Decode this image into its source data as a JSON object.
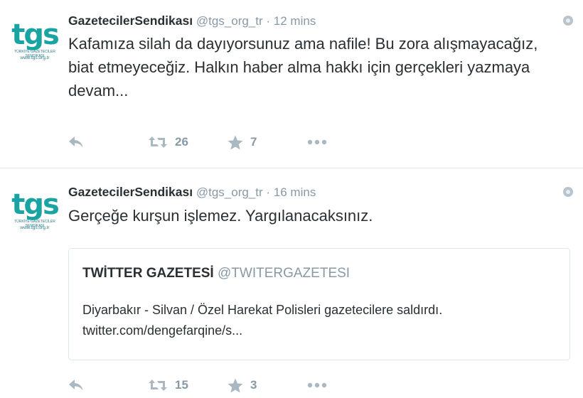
{
  "tweets": [
    {
      "avatar": {
        "logo": "tgs",
        "subtitle": "TÜRKİYE GAZETECİLER SENDİKASI",
        "url": "www.tgs.org.tr"
      },
      "name": "GazetecilerSendikası",
      "handle": "@tgs_org_tr",
      "separator": "·",
      "time": "12 mins",
      "text": "Kafamıza silah da dayıyorsunuz ama nafile! Bu zora alışmayacağız, biat etmeyeceğiz. Halkın haber alma hakkı için gerçekleri yazmaya devam...",
      "retweets": "26",
      "favorites": "7"
    },
    {
      "avatar": {
        "logo": "tgs",
        "subtitle": "TÜRKİYE GAZETECİLER SENDİKASI",
        "url": "www.tgs.org.tr"
      },
      "name": "GazetecilerSendikası",
      "handle": "@tgs_org_tr",
      "separator": "·",
      "time": "16 mins",
      "text": "Gerçeğe kurşun işlemez. Yargılanacaksınız.",
      "quote": {
        "name": "TWİTTER GAZETESİ",
        "handle": "@TWITERGAZETESI",
        "text": "Diyarbakır - Silvan / Özel Harekat Polisleri gazetecilere saldırdı. twitter.com/dengefarqine/s..."
      },
      "retweets": "15",
      "favorites": "3"
    }
  ],
  "icons": {
    "reply": "reply-icon",
    "retweet": "retweet-icon",
    "favorite": "star-icon",
    "more": "more-icon",
    "geo": "geo-icon"
  },
  "colors": {
    "logo": "#1aa3a3",
    "muted": "#8899a6",
    "icon": "#aab8c2",
    "text": "#292f33",
    "divider": "#e1e8ed"
  }
}
